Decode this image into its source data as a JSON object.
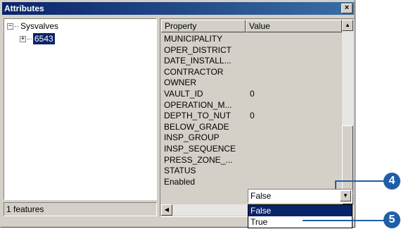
{
  "window": {
    "title": "Attributes",
    "close_glyph": "×"
  },
  "tree": {
    "root": {
      "expander": "−",
      "label": "Sysvalves"
    },
    "child": {
      "expander": "+",
      "label": "6543"
    }
  },
  "status": {
    "text": "1 features"
  },
  "grid": {
    "headers": {
      "property": "Property",
      "value": "Value"
    },
    "rows": [
      {
        "property": "MUNICIPALITY",
        "value": ""
      },
      {
        "property": "OPER_DISTRICT",
        "value": ""
      },
      {
        "property": "DATE_INSTALL...",
        "value": ""
      },
      {
        "property": "CONTRACTOR",
        "value": ""
      },
      {
        "property": "OWNER",
        "value": ""
      },
      {
        "property": "VAULT_ID",
        "value": "0"
      },
      {
        "property": "OPERATION_M...",
        "value": ""
      },
      {
        "property": "DEPTH_TO_NUT",
        "value": "0"
      },
      {
        "property": "BELOW_GRADE",
        "value": ""
      },
      {
        "property": "INSP_GROUP",
        "value": ""
      },
      {
        "property": "INSP_SEQUENCE",
        "value": ""
      },
      {
        "property": "PRESS_ZONE_...",
        "value": ""
      },
      {
        "property": "STATUS",
        "value": ""
      },
      {
        "property": "Enabled",
        "value": ""
      }
    ]
  },
  "dropdown": {
    "selected": "False",
    "options": [
      "False",
      "True"
    ],
    "highlighted_index": 0
  },
  "callouts": {
    "step_a": "4",
    "step_b": "5"
  },
  "colors": {
    "titlebar": "#0a246a",
    "selection": "#0a246a",
    "callout": "#1f5fa8",
    "face": "#d4d0c8"
  },
  "icons": {
    "close": "close-icon",
    "scroll_up": "arrow-up-icon",
    "scroll_down": "arrow-down-icon",
    "scroll_left": "arrow-left-icon",
    "dropdown": "chevron-down-icon",
    "resize": "resize-grip-icon"
  }
}
